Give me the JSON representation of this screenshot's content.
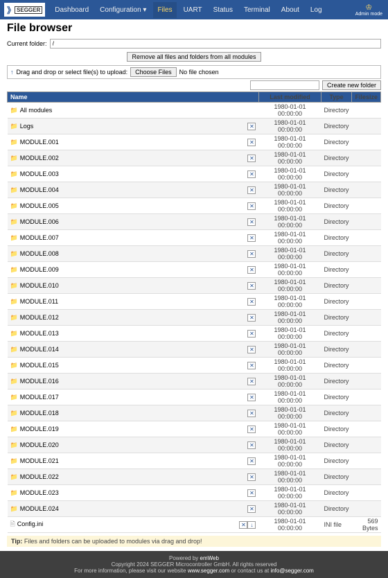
{
  "nav": {
    "logo_text": "SEGGER",
    "items": [
      "Dashboard",
      "Configuration ▾",
      "Files",
      "UART",
      "Status",
      "Terminal",
      "About",
      "Log"
    ],
    "active_index": 2,
    "admin_label": "Admin\nmode"
  },
  "page": {
    "title": "File browser",
    "current_folder_label": "Current folder:",
    "current_folder_value": "/",
    "remove_all_btn": "Remove all files and folders from all modules",
    "upload_hint": "Drag and drop or select file(s) to upload:",
    "choose_files_btn": "Choose Files",
    "no_file_chosen": "No file chosen",
    "create_folder_btn": "Create new folder",
    "tip_label": "Tip:",
    "tip_text": "Files and folders can be uploaded to modules via drag and drop!"
  },
  "table": {
    "headers": [
      "Name",
      "",
      "Last modified",
      "Type",
      "Filesize"
    ]
  },
  "rows": [
    {
      "name": "All modules",
      "icon": "folder",
      "actions": [],
      "mod": "1980-01-01 00:00:00",
      "type": "Directory",
      "size": ""
    },
    {
      "name": "Logs",
      "icon": "folder",
      "actions": [
        "x"
      ],
      "mod": "1980-01-01 00:00:00",
      "type": "Directory",
      "size": ""
    },
    {
      "name": "MODULE.001",
      "icon": "folder",
      "actions": [
        "x"
      ],
      "mod": "1980-01-01 00:00:00",
      "type": "Directory",
      "size": ""
    },
    {
      "name": "MODULE.002",
      "icon": "folder",
      "actions": [
        "x"
      ],
      "mod": "1980-01-01 00:00:00",
      "type": "Directory",
      "size": ""
    },
    {
      "name": "MODULE.003",
      "icon": "folder",
      "actions": [
        "x"
      ],
      "mod": "1980-01-01 00:00:00",
      "type": "Directory",
      "size": ""
    },
    {
      "name": "MODULE.004",
      "icon": "folder",
      "actions": [
        "x"
      ],
      "mod": "1980-01-01 00:00:00",
      "type": "Directory",
      "size": ""
    },
    {
      "name": "MODULE.005",
      "icon": "folder",
      "actions": [
        "x"
      ],
      "mod": "1980-01-01 00:00:00",
      "type": "Directory",
      "size": ""
    },
    {
      "name": "MODULE.006",
      "icon": "folder",
      "actions": [
        "x"
      ],
      "mod": "1980-01-01 00:00:00",
      "type": "Directory",
      "size": ""
    },
    {
      "name": "MODULE.007",
      "icon": "folder",
      "actions": [
        "x"
      ],
      "mod": "1980-01-01 00:00:00",
      "type": "Directory",
      "size": ""
    },
    {
      "name": "MODULE.008",
      "icon": "folder",
      "actions": [
        "x"
      ],
      "mod": "1980-01-01 00:00:00",
      "type": "Directory",
      "size": ""
    },
    {
      "name": "MODULE.009",
      "icon": "folder",
      "actions": [
        "x"
      ],
      "mod": "1980-01-01 00:00:00",
      "type": "Directory",
      "size": ""
    },
    {
      "name": "MODULE.010",
      "icon": "folder",
      "actions": [
        "x"
      ],
      "mod": "1980-01-01 00:00:00",
      "type": "Directory",
      "size": ""
    },
    {
      "name": "MODULE.011",
      "icon": "folder",
      "actions": [
        "x"
      ],
      "mod": "1980-01-01 00:00:00",
      "type": "Directory",
      "size": ""
    },
    {
      "name": "MODULE.012",
      "icon": "folder",
      "actions": [
        "x"
      ],
      "mod": "1980-01-01 00:00:00",
      "type": "Directory",
      "size": ""
    },
    {
      "name": "MODULE.013",
      "icon": "folder",
      "actions": [
        "x"
      ],
      "mod": "1980-01-01 00:00:00",
      "type": "Directory",
      "size": ""
    },
    {
      "name": "MODULE.014",
      "icon": "folder",
      "actions": [
        "x"
      ],
      "mod": "1980-01-01 00:00:00",
      "type": "Directory",
      "size": ""
    },
    {
      "name": "MODULE.015",
      "icon": "folder",
      "actions": [
        "x"
      ],
      "mod": "1980-01-01 00:00:00",
      "type": "Directory",
      "size": ""
    },
    {
      "name": "MODULE.016",
      "icon": "folder",
      "actions": [
        "x"
      ],
      "mod": "1980-01-01 00:00:00",
      "type": "Directory",
      "size": ""
    },
    {
      "name": "MODULE.017",
      "icon": "folder",
      "actions": [
        "x"
      ],
      "mod": "1980-01-01 00:00:00",
      "type": "Directory",
      "size": ""
    },
    {
      "name": "MODULE.018",
      "icon": "folder",
      "actions": [
        "x"
      ],
      "mod": "1980-01-01 00:00:00",
      "type": "Directory",
      "size": ""
    },
    {
      "name": "MODULE.019",
      "icon": "folder",
      "actions": [
        "x"
      ],
      "mod": "1980-01-01 00:00:00",
      "type": "Directory",
      "size": ""
    },
    {
      "name": "MODULE.020",
      "icon": "folder",
      "actions": [
        "x"
      ],
      "mod": "1980-01-01 00:00:00",
      "type": "Directory",
      "size": ""
    },
    {
      "name": "MODULE.021",
      "icon": "folder",
      "actions": [
        "x"
      ],
      "mod": "1980-01-01 00:00:00",
      "type": "Directory",
      "size": ""
    },
    {
      "name": "MODULE.022",
      "icon": "folder",
      "actions": [
        "x"
      ],
      "mod": "1980-01-01 00:00:00",
      "type": "Directory",
      "size": ""
    },
    {
      "name": "MODULE.023",
      "icon": "folder",
      "actions": [
        "x"
      ],
      "mod": "1980-01-01 00:00:00",
      "type": "Directory",
      "size": ""
    },
    {
      "name": "MODULE.024",
      "icon": "folder",
      "actions": [
        "x"
      ],
      "mod": "1980-01-01 00:00:00",
      "type": "Directory",
      "size": ""
    },
    {
      "name": "Config.ini",
      "icon": "file",
      "actions": [
        "x",
        "d"
      ],
      "mod": "1980-01-01 00:00:00",
      "type": "INI file",
      "size": "569 Bytes"
    }
  ],
  "footer": {
    "powered": "Powered by",
    "powered_link": "emWeb",
    "copyright": "Copyright 2024 SEGGER Microcontroller GmbH. All rights reserved",
    "more_pre": "For more information, please visit our website",
    "more_url": "www.segger.com",
    "more_mid": "or contact us at",
    "more_email": "info@segger.com"
  }
}
